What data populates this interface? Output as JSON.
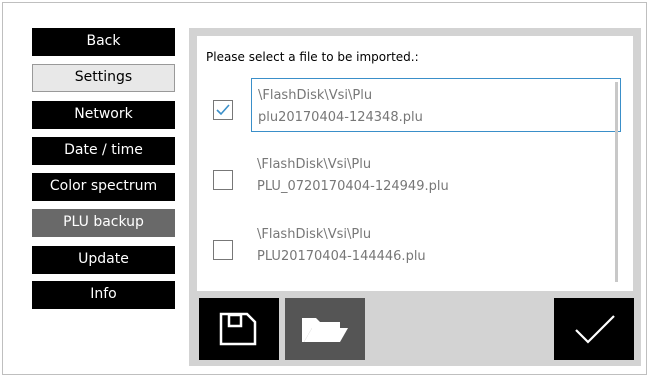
{
  "menu": {
    "back": "Back",
    "settings": "Settings",
    "items": [
      "Network",
      "Date / time",
      "Color spectrum",
      "PLU backup",
      "Update",
      "Info"
    ]
  },
  "prompt": "Please select a file to be imported.:",
  "files": [
    {
      "path": "\\FlashDisk\\Vsi\\Plu",
      "name": "plu20170404-124348.plu",
      "checked": true
    },
    {
      "path": "\\FlashDisk\\Vsi\\Plu",
      "name": "PLU_0720170404-124949.plu",
      "checked": false
    },
    {
      "path": "\\FlashDisk\\Vsi\\Plu",
      "name": "PLU20170404-144446.plu",
      "checked": false
    }
  ],
  "icons": {
    "save": "floppy-disk-icon",
    "open": "folder-open-icon",
    "confirm": "checkmark-icon"
  },
  "colors": {
    "active_menu": "#696969",
    "selection_border": "#3a8fc9",
    "panel": "#d3d3d3"
  }
}
